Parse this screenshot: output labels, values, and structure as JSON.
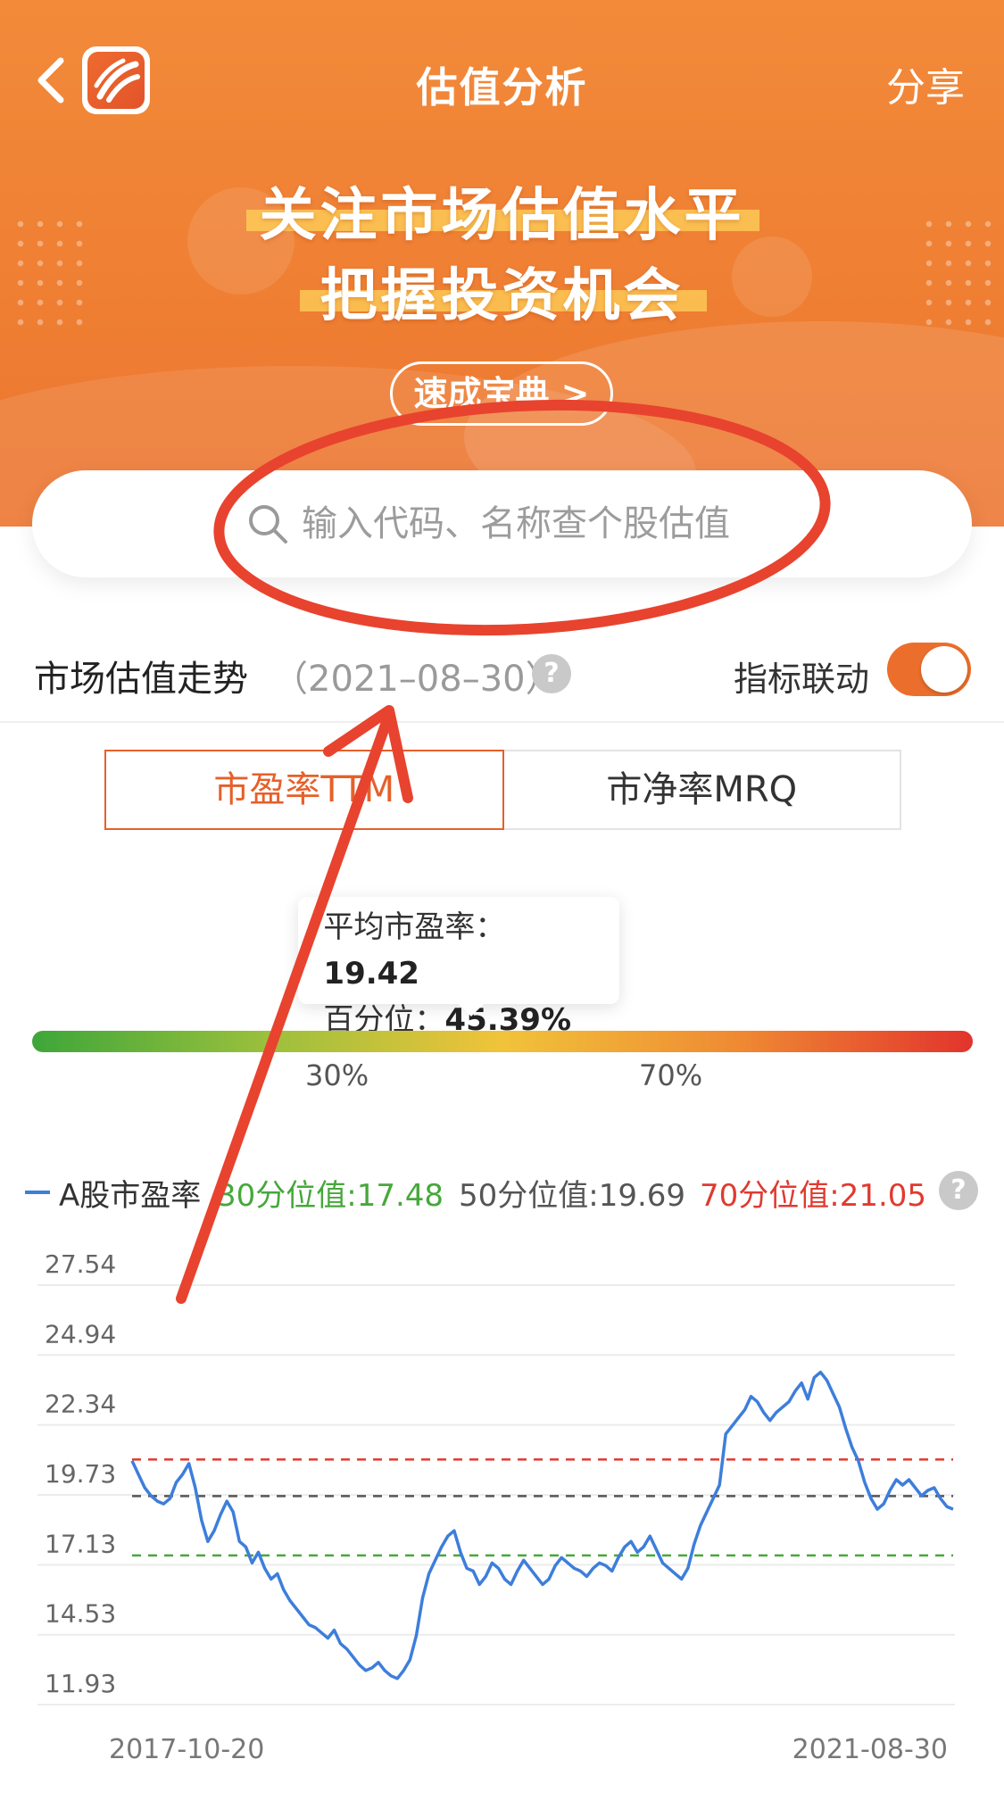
{
  "header": {
    "title": "估值分析",
    "share_label": "分享"
  },
  "banner": {
    "headline_line1": "关注市场估值水平",
    "headline_line2": "把握投资机会",
    "guide_button": "速成宝典 >"
  },
  "search": {
    "placeholder": "输入代码、名称查个股估值"
  },
  "section": {
    "title": "市场估值走势",
    "date": "（2021–08–30）",
    "link_label": "指标联动",
    "toggle_on": true
  },
  "tabs": [
    {
      "label": "市盈率TTM",
      "active": true
    },
    {
      "label": "市净率MRQ",
      "active": false
    }
  ],
  "tooltip": {
    "avg_label": "平均市盈率：",
    "avg_value": "19.42",
    "pct_label": "百分位：",
    "pct_value": "45.39%",
    "position": 0.4539
  },
  "gradient_bar": {
    "label_30": "30%",
    "label_70": "70%"
  },
  "legend": {
    "series_name": "A股市盈率",
    "p30": "30分位值:17.48",
    "p50": "50分位值:19.69",
    "p70": "70分位值:21.05"
  },
  "colors": {
    "accent": "#ec6e2c",
    "series": "#3d7edb",
    "p30": "#46a83b",
    "p50": "#555555",
    "p70": "#e03a30"
  },
  "chart_data": {
    "type": "line",
    "yticks": [
      "27.54",
      "24.94",
      "22.34",
      "19.73",
      "17.13",
      "14.53",
      "11.93"
    ],
    "ylim": [
      11.93,
      27.54
    ],
    "x_start_label": "2017-10-20",
    "x_end_label": "2021-08-30",
    "thresholds": {
      "p30": 17.48,
      "p50": 19.69,
      "p70": 21.05
    },
    "series": [
      {
        "name": "A股市盈率",
        "values": [
          21.0,
          20.5,
          20.0,
          19.7,
          19.5,
          19.4,
          19.6,
          20.2,
          20.5,
          20.9,
          20.0,
          18.8,
          18.0,
          18.4,
          19.0,
          19.5,
          19.1,
          18.0,
          17.8,
          17.2,
          17.6,
          17.0,
          16.6,
          16.8,
          16.2,
          15.8,
          15.5,
          15.2,
          14.9,
          14.8,
          14.6,
          14.4,
          14.7,
          14.2,
          14.0,
          13.7,
          13.4,
          13.2,
          13.3,
          13.5,
          13.2,
          13.0,
          12.9,
          13.2,
          13.6,
          14.5,
          15.9,
          16.8,
          17.3,
          17.8,
          18.2,
          18.4,
          17.6,
          17.0,
          16.9,
          16.4,
          16.7,
          17.2,
          17.0,
          16.6,
          16.4,
          16.9,
          17.3,
          17.0,
          16.7,
          16.4,
          16.6,
          17.1,
          17.4,
          17.2,
          17.0,
          16.9,
          16.7,
          17.0,
          17.2,
          17.1,
          16.9,
          17.4,
          17.8,
          18.0,
          17.6,
          17.8,
          18.2,
          17.7,
          17.2,
          17.0,
          16.8,
          16.6,
          17.0,
          17.9,
          18.6,
          19.1,
          19.6,
          20.1,
          22.0,
          22.3,
          22.6,
          22.9,
          23.4,
          23.2,
          22.8,
          22.5,
          22.8,
          23.0,
          23.2,
          23.6,
          23.9,
          23.3,
          24.1,
          24.3,
          24.0,
          23.5,
          23.0,
          22.2,
          21.5,
          21.0,
          20.2,
          19.6,
          19.2,
          19.4,
          19.9,
          20.3,
          20.1,
          20.3,
          20.0,
          19.7,
          19.9,
          20.0,
          19.6,
          19.3,
          19.2
        ]
      }
    ]
  }
}
